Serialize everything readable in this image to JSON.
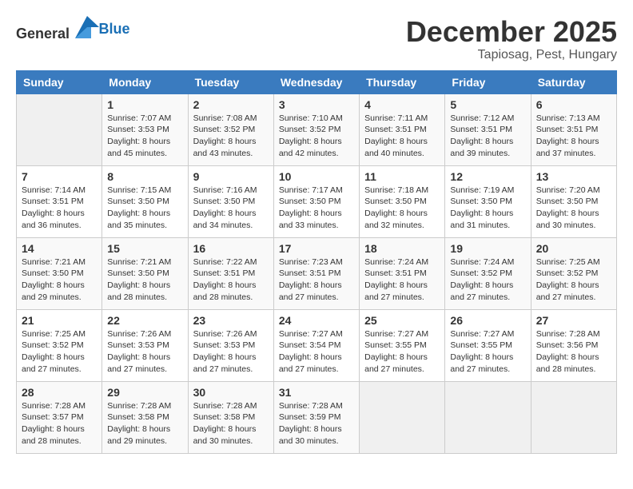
{
  "header": {
    "logo_general": "General",
    "logo_blue": "Blue",
    "month": "December 2025",
    "location": "Tapiosag, Pest, Hungary"
  },
  "weekdays": [
    "Sunday",
    "Monday",
    "Tuesday",
    "Wednesday",
    "Thursday",
    "Friday",
    "Saturday"
  ],
  "weeks": [
    [
      {
        "day": "",
        "info": ""
      },
      {
        "day": "1",
        "info": "Sunrise: 7:07 AM\nSunset: 3:53 PM\nDaylight: 8 hours\nand 45 minutes."
      },
      {
        "day": "2",
        "info": "Sunrise: 7:08 AM\nSunset: 3:52 PM\nDaylight: 8 hours\nand 43 minutes."
      },
      {
        "day": "3",
        "info": "Sunrise: 7:10 AM\nSunset: 3:52 PM\nDaylight: 8 hours\nand 42 minutes."
      },
      {
        "day": "4",
        "info": "Sunrise: 7:11 AM\nSunset: 3:51 PM\nDaylight: 8 hours\nand 40 minutes."
      },
      {
        "day": "5",
        "info": "Sunrise: 7:12 AM\nSunset: 3:51 PM\nDaylight: 8 hours\nand 39 minutes."
      },
      {
        "day": "6",
        "info": "Sunrise: 7:13 AM\nSunset: 3:51 PM\nDaylight: 8 hours\nand 37 minutes."
      }
    ],
    [
      {
        "day": "7",
        "info": "Sunrise: 7:14 AM\nSunset: 3:51 PM\nDaylight: 8 hours\nand 36 minutes."
      },
      {
        "day": "8",
        "info": "Sunrise: 7:15 AM\nSunset: 3:50 PM\nDaylight: 8 hours\nand 35 minutes."
      },
      {
        "day": "9",
        "info": "Sunrise: 7:16 AM\nSunset: 3:50 PM\nDaylight: 8 hours\nand 34 minutes."
      },
      {
        "day": "10",
        "info": "Sunrise: 7:17 AM\nSunset: 3:50 PM\nDaylight: 8 hours\nand 33 minutes."
      },
      {
        "day": "11",
        "info": "Sunrise: 7:18 AM\nSunset: 3:50 PM\nDaylight: 8 hours\nand 32 minutes."
      },
      {
        "day": "12",
        "info": "Sunrise: 7:19 AM\nSunset: 3:50 PM\nDaylight: 8 hours\nand 31 minutes."
      },
      {
        "day": "13",
        "info": "Sunrise: 7:20 AM\nSunset: 3:50 PM\nDaylight: 8 hours\nand 30 minutes."
      }
    ],
    [
      {
        "day": "14",
        "info": "Sunrise: 7:21 AM\nSunset: 3:50 PM\nDaylight: 8 hours\nand 29 minutes."
      },
      {
        "day": "15",
        "info": "Sunrise: 7:21 AM\nSunset: 3:50 PM\nDaylight: 8 hours\nand 28 minutes."
      },
      {
        "day": "16",
        "info": "Sunrise: 7:22 AM\nSunset: 3:51 PM\nDaylight: 8 hours\nand 28 minutes."
      },
      {
        "day": "17",
        "info": "Sunrise: 7:23 AM\nSunset: 3:51 PM\nDaylight: 8 hours\nand 27 minutes."
      },
      {
        "day": "18",
        "info": "Sunrise: 7:24 AM\nSunset: 3:51 PM\nDaylight: 8 hours\nand 27 minutes."
      },
      {
        "day": "19",
        "info": "Sunrise: 7:24 AM\nSunset: 3:52 PM\nDaylight: 8 hours\nand 27 minutes."
      },
      {
        "day": "20",
        "info": "Sunrise: 7:25 AM\nSunset: 3:52 PM\nDaylight: 8 hours\nand 27 minutes."
      }
    ],
    [
      {
        "day": "21",
        "info": "Sunrise: 7:25 AM\nSunset: 3:52 PM\nDaylight: 8 hours\nand 27 minutes."
      },
      {
        "day": "22",
        "info": "Sunrise: 7:26 AM\nSunset: 3:53 PM\nDaylight: 8 hours\nand 27 minutes."
      },
      {
        "day": "23",
        "info": "Sunrise: 7:26 AM\nSunset: 3:53 PM\nDaylight: 8 hours\nand 27 minutes."
      },
      {
        "day": "24",
        "info": "Sunrise: 7:27 AM\nSunset: 3:54 PM\nDaylight: 8 hours\nand 27 minutes."
      },
      {
        "day": "25",
        "info": "Sunrise: 7:27 AM\nSunset: 3:55 PM\nDaylight: 8 hours\nand 27 minutes."
      },
      {
        "day": "26",
        "info": "Sunrise: 7:27 AM\nSunset: 3:55 PM\nDaylight: 8 hours\nand 27 minutes."
      },
      {
        "day": "27",
        "info": "Sunrise: 7:28 AM\nSunset: 3:56 PM\nDaylight: 8 hours\nand 28 minutes."
      }
    ],
    [
      {
        "day": "28",
        "info": "Sunrise: 7:28 AM\nSunset: 3:57 PM\nDaylight: 8 hours\nand 28 minutes."
      },
      {
        "day": "29",
        "info": "Sunrise: 7:28 AM\nSunset: 3:58 PM\nDaylight: 8 hours\nand 29 minutes."
      },
      {
        "day": "30",
        "info": "Sunrise: 7:28 AM\nSunset: 3:58 PM\nDaylight: 8 hours\nand 30 minutes."
      },
      {
        "day": "31",
        "info": "Sunrise: 7:28 AM\nSunset: 3:59 PM\nDaylight: 8 hours\nand 30 minutes."
      },
      {
        "day": "",
        "info": ""
      },
      {
        "day": "",
        "info": ""
      },
      {
        "day": "",
        "info": ""
      }
    ]
  ]
}
